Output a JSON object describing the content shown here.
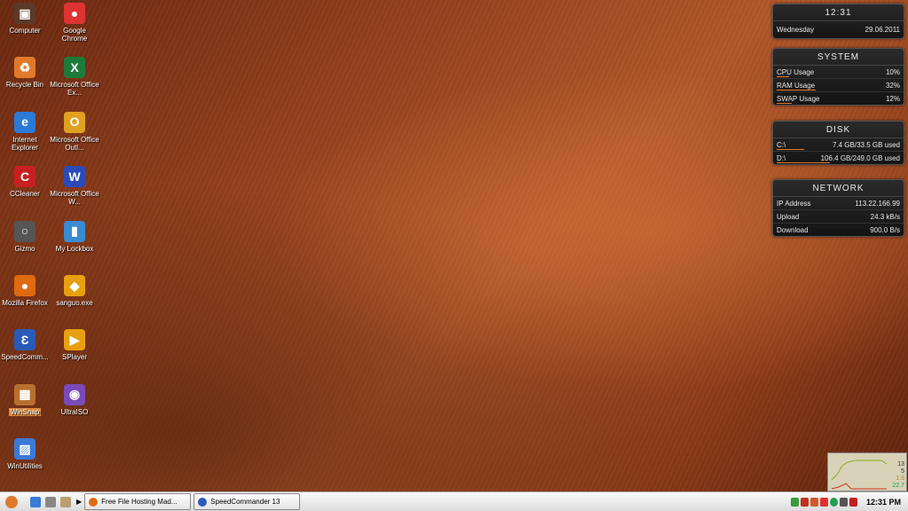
{
  "desktop": {
    "icons": [
      {
        "label": "Computer",
        "glyph": "▣",
        "color": "#5a3a2a"
      },
      {
        "label": "Google Chrome",
        "glyph": "●",
        "color": "#d33"
      },
      {
        "label": "Recycle Bin",
        "glyph": "♻",
        "color": "#e07a2a"
      },
      {
        "label": "Microsoft Office Ex...",
        "glyph": "X",
        "color": "#1e7a3a"
      },
      {
        "label": "Internet Explorer",
        "glyph": "e",
        "color": "#2a7ad8"
      },
      {
        "label": "Microsoft Office Outl...",
        "glyph": "O",
        "color": "#e0a020"
      },
      {
        "label": "CCleaner",
        "glyph": "C",
        "color": "#c82020"
      },
      {
        "label": "Microsoft Office W...",
        "glyph": "W",
        "color": "#2a4ab8"
      },
      {
        "label": "Gizmo",
        "glyph": "○",
        "color": "#555"
      },
      {
        "label": "My Lockbox",
        "glyph": "▮",
        "color": "#3a8ad0"
      },
      {
        "label": "Mozilla Firefox",
        "glyph": "●",
        "color": "#e06a10"
      },
      {
        "label": "sanguo.exe",
        "glyph": "◆",
        "color": "#e8a010"
      },
      {
        "label": "SpeedComm...",
        "glyph": "Ɛ",
        "color": "#2a5ab8"
      },
      {
        "label": "SPlayer",
        "glyph": "▶",
        "color": "#e8a010"
      },
      {
        "label": "WinSnap",
        "glyph": "▦",
        "color": "#b87030"
      },
      {
        "label": "UltraISO",
        "glyph": "◉",
        "color": "#7a4ab8"
      },
      {
        "label": "WinUtilities",
        "glyph": "▨",
        "color": "#3a7ad8"
      }
    ]
  },
  "clock_gadget": {
    "time": "12:31",
    "day": "Wednesday",
    "date": "29.06.2011"
  },
  "system_gadget": {
    "title": "SYSTEM",
    "rows": [
      {
        "label": "CPU Usage",
        "value": "10%",
        "level": 0.1
      },
      {
        "label": "RAM Usage",
        "value": "32%",
        "level": 0.32
      },
      {
        "label": "SWAP Usage",
        "value": "12%",
        "level": 0.12
      }
    ]
  },
  "disk_gadget": {
    "title": "DISK",
    "rows": [
      {
        "label": "C:\\",
        "value": "7.4 GB/33.5 GB used",
        "level": 0.22
      },
      {
        "label": "D:\\",
        "value": "106.4 GB/249.0 GB used",
        "level": 0.43
      }
    ]
  },
  "network_gadget": {
    "title": "NETWORK",
    "rows": [
      {
        "label": "IP Address",
        "value": "113.22.166.99"
      },
      {
        "label": "Upload",
        "value": "24.3 kB/s"
      },
      {
        "label": "Download",
        "value": "900.0 B/s"
      }
    ]
  },
  "taskbar": {
    "windows": [
      {
        "label": "Free File Hosting Mad...",
        "color": "#e06a10"
      },
      {
        "label": "SpeedCommander 13",
        "color": "#2a5ab8"
      }
    ],
    "clock": "12:31 PM"
  },
  "monitor": {
    "values": [
      "13",
      "5",
      "1.6",
      "22.7"
    ]
  }
}
